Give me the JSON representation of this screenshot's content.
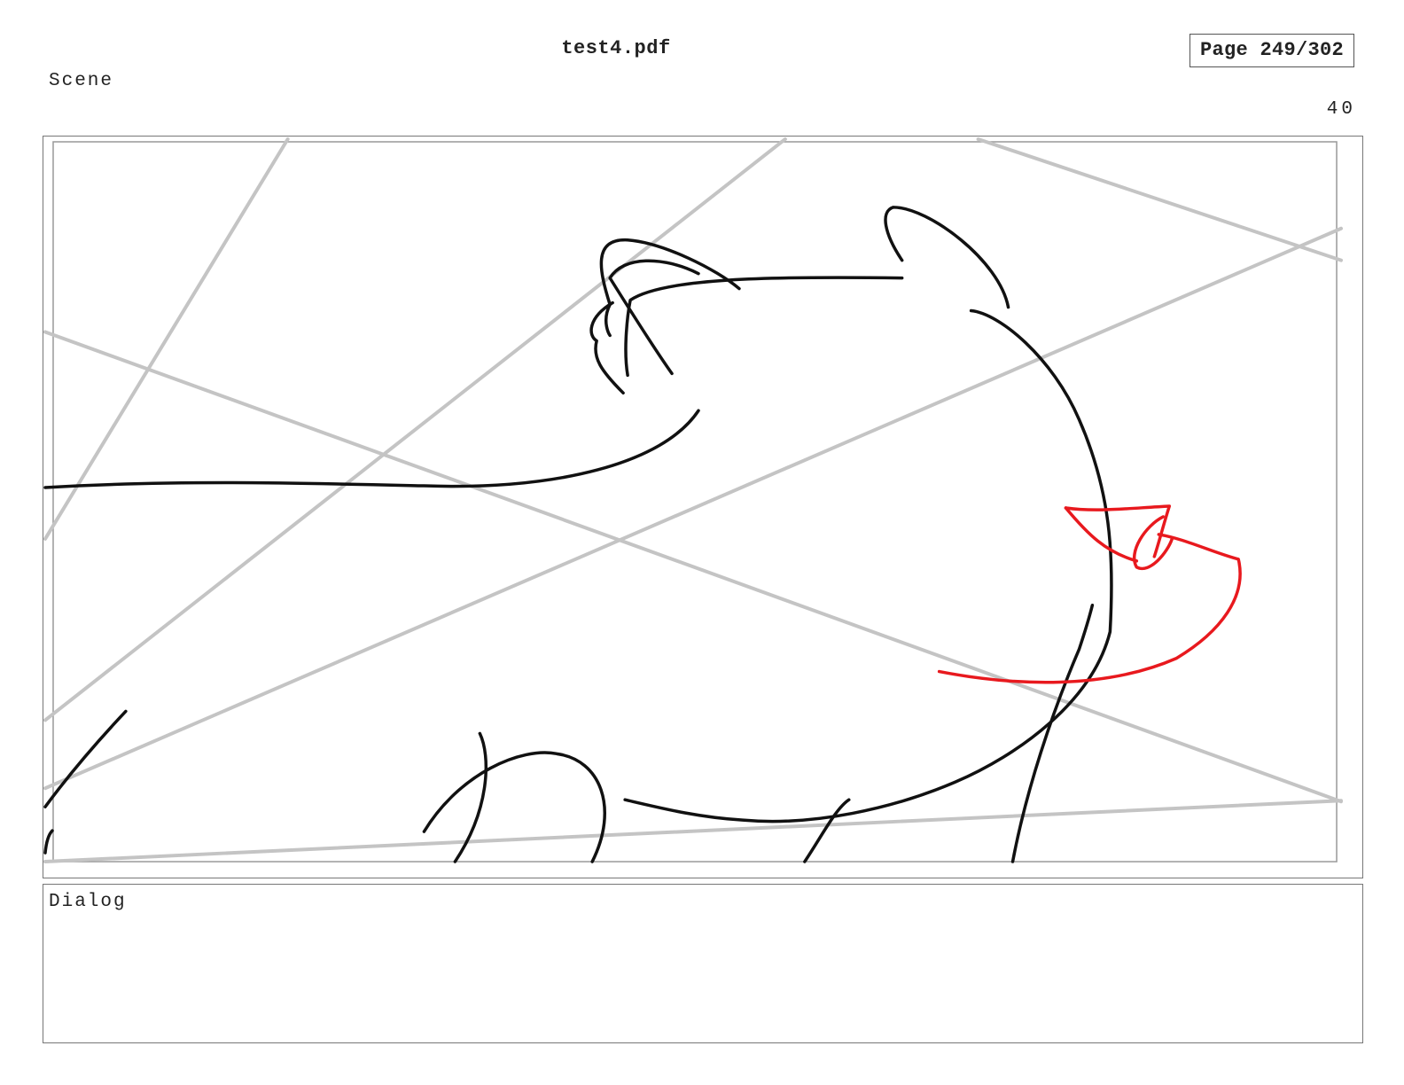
{
  "header": {
    "document_title": "test4.pdf",
    "page_indicator": "Page 249/302"
  },
  "panel": {
    "scene_label": "Scene",
    "scene_number": "40",
    "dialog_label": "Dialog",
    "dialog_text": ""
  },
  "colors": {
    "sketch_line": "#111111",
    "correction_line": "#e8191e",
    "perspective_guide": "#c4c4c4",
    "frame_border": "#777777"
  }
}
